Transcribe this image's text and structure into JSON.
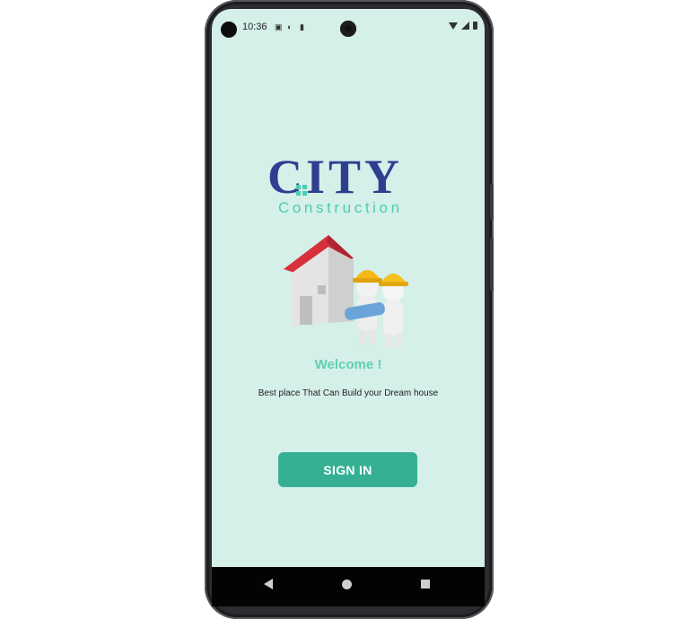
{
  "status_bar": {
    "time": "10:36",
    "left_icons": [
      "image-icon",
      "circle-app-icon",
      "sim-icon"
    ],
    "right_icons": [
      "wifi-icon",
      "signal-icon",
      "battery-icon"
    ]
  },
  "logo": {
    "main_text": "CITY",
    "sub_text": "Construction",
    "colors": {
      "main": "#2f3f90",
      "sub": "#4ccdb0"
    }
  },
  "illustration": {
    "icon": "house-workers-illustration"
  },
  "welcome": {
    "title": "Welcome !",
    "tagline": "Best place That Can Build your Dream house"
  },
  "signin_button": {
    "label": "SIGN IN",
    "color": "#35b094"
  },
  "nav_bar": {
    "buttons": [
      "back-icon",
      "home-icon",
      "recents-icon"
    ]
  },
  "theme": {
    "background": "#d5efe9",
    "welcome_color": "#5ed0b3"
  }
}
